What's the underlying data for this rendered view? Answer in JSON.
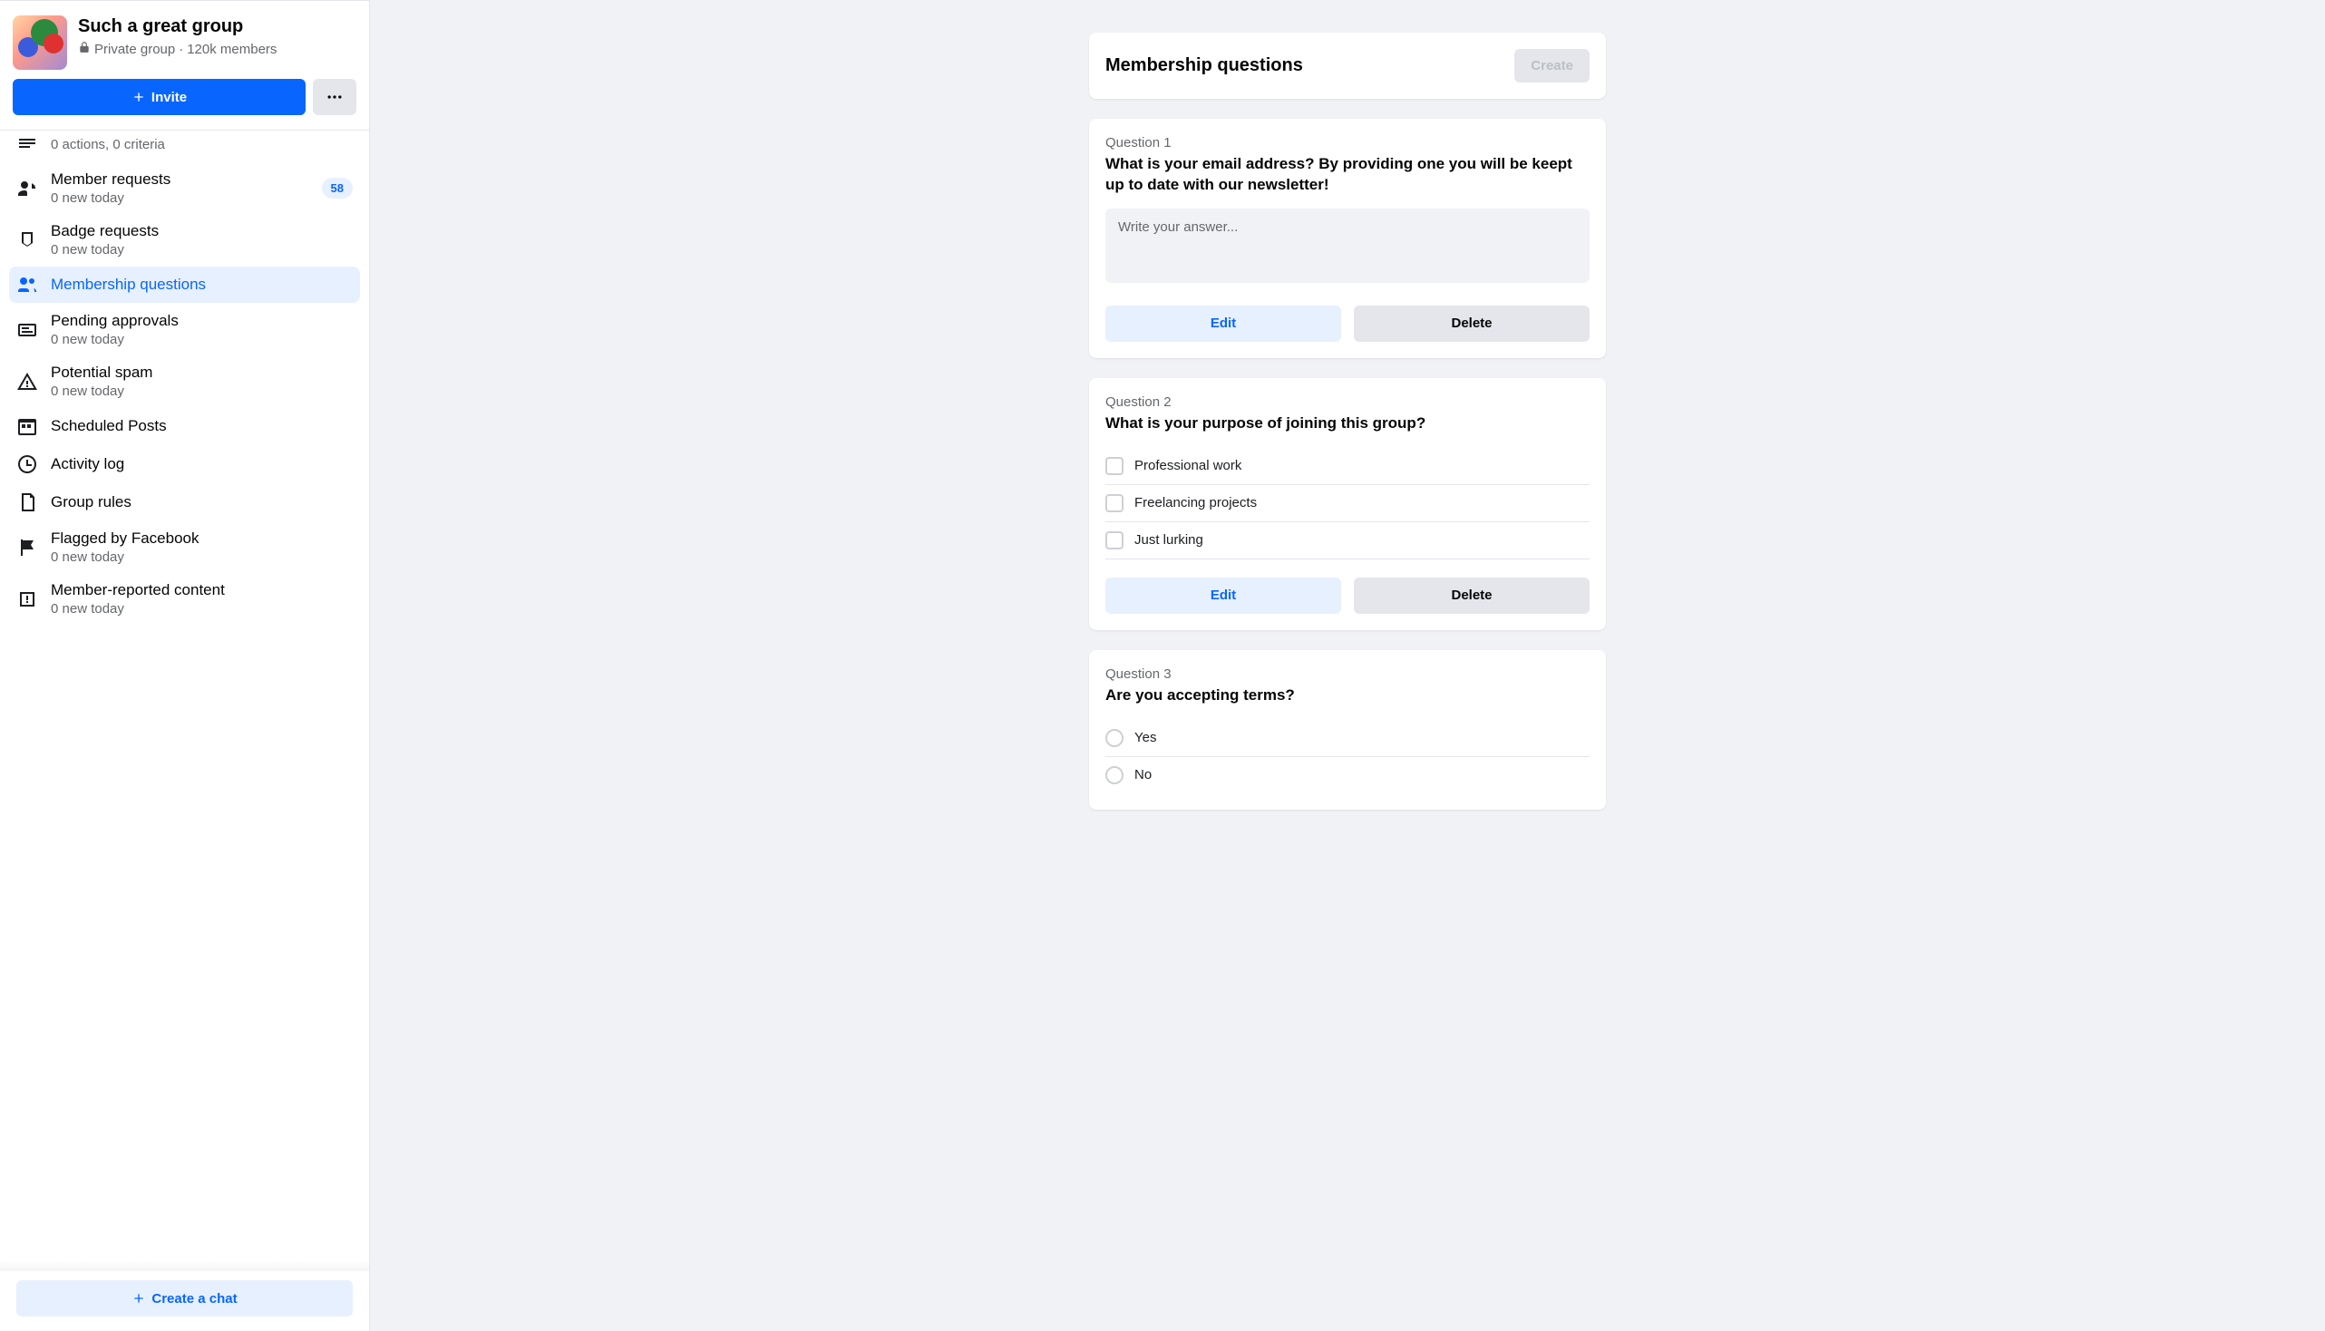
{
  "group": {
    "name": "Such a great group",
    "privacy": "Private group",
    "members": "120k members",
    "invite_label": "Invite"
  },
  "sidebar": {
    "partial_sub": "0 actions, 0 criteria",
    "items": [
      {
        "label": "Member requests",
        "sub": "0 new today",
        "badge": "58"
      },
      {
        "label": "Badge requests",
        "sub": "0 new today"
      },
      {
        "label": "Membership questions"
      },
      {
        "label": "Pending approvals",
        "sub": "0 new today"
      },
      {
        "label": "Potential spam",
        "sub": "0 new today"
      },
      {
        "label": "Scheduled Posts"
      },
      {
        "label": "Activity log"
      },
      {
        "label": "Group rules"
      },
      {
        "label": "Flagged by Facebook",
        "sub": "0 new today"
      },
      {
        "label": "Member-reported content",
        "sub": "0 new today"
      }
    ],
    "create_chat": "Create a chat"
  },
  "main": {
    "title": "Membership questions",
    "create_button": "Create",
    "edit_label": "Edit",
    "delete_label": "Delete",
    "answer_placeholder": "Write your answer...",
    "questions": [
      {
        "num": "Question 1",
        "text": "What is your email address? By providing one you will be keept up to date with our newsletter!"
      },
      {
        "num": "Question 2",
        "text": "What is your purpose of joining this group?",
        "checkbox_options": [
          "Professional work",
          "Freelancing projects",
          "Just lurking"
        ]
      },
      {
        "num": "Question 3",
        "text": "Are you accepting terms?",
        "radio_options": [
          "Yes",
          "No"
        ]
      }
    ]
  }
}
